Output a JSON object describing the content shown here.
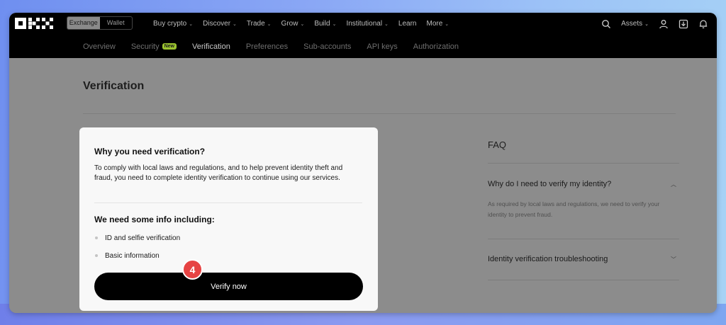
{
  "topbar": {
    "logo_text": "OKX",
    "mode_toggle": [
      "Exchange",
      "Wallet"
    ],
    "nav": [
      {
        "label": "Buy crypto",
        "has_dropdown": true
      },
      {
        "label": "Discover",
        "has_dropdown": true
      },
      {
        "label": "Trade",
        "has_dropdown": true
      },
      {
        "label": "Grow",
        "has_dropdown": true
      },
      {
        "label": "Build",
        "has_dropdown": true
      },
      {
        "label": "Institutional",
        "has_dropdown": true
      },
      {
        "label": "Learn",
        "has_dropdown": false
      },
      {
        "label": "More",
        "has_dropdown": true
      }
    ],
    "assets_label": "Assets",
    "icons": [
      "search-icon",
      "user-icon",
      "download-icon",
      "bell-icon"
    ]
  },
  "subnav": {
    "items": [
      "Overview",
      "Security",
      "Verification",
      "Preferences",
      "Sub-accounts",
      "API keys",
      "Authorization"
    ],
    "active": "Verification",
    "new_badge": "New"
  },
  "page": {
    "title": "Verification"
  },
  "modal": {
    "heading": "Why you need verification?",
    "description": "To comply with local laws and regulations, and to help prevent identity theft and fraud, you need to complete identity verification to continue using our services.",
    "info_heading": "We need some info including:",
    "info_items": [
      "ID and selfie verification",
      "Basic information"
    ],
    "button_label": "Verify now",
    "step_badge": "4"
  },
  "faq": {
    "title": "FAQ",
    "items": [
      {
        "question": "Why do I need to verify my identity?",
        "answer": "As required by local laws and regulations, we need to verify your identity to prevent fraud.",
        "expanded": true
      },
      {
        "question": "Identity verification troubleshooting",
        "expanded": false
      }
    ]
  },
  "colors": {
    "accent_new_badge": "#9bc32f",
    "step_badge": "#e64343",
    "button": "#000000"
  }
}
